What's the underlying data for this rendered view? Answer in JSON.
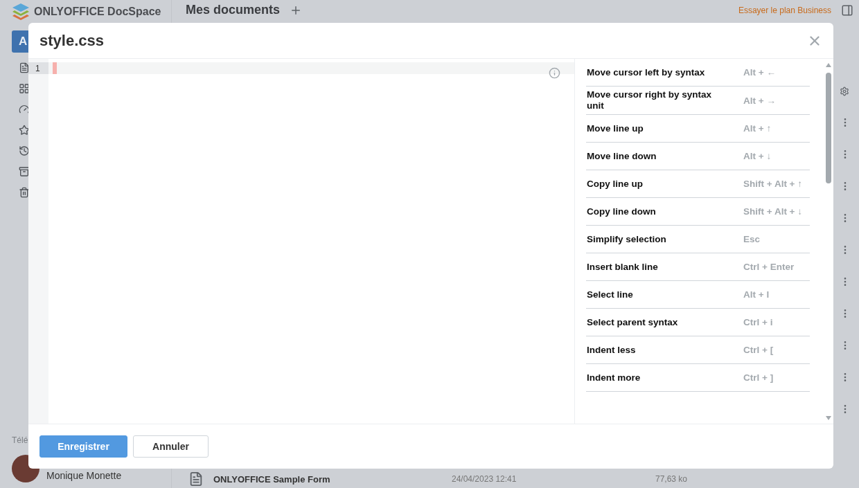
{
  "app": {
    "brand": "ONLYOFFICE DocSpace",
    "section_title": "Mes documents",
    "upgrade_link": "Essayer le plan Business",
    "sidebar_action": "A",
    "download_label": "Télé",
    "user_name": "Monique Monette"
  },
  "file_row": {
    "name": "ONLYOFFICE Sample Form",
    "modified": "24/04/2023 12:41",
    "size": "77,63 ko"
  },
  "dialog": {
    "title": "style.css",
    "editor": {
      "lines": [
        {
          "number": "1",
          "active": true
        }
      ]
    },
    "shortcuts": [
      {
        "name": "Move cursor left by syntax",
        "keys": "Alt + ←"
      },
      {
        "name": "Move cursor right by syntax unit",
        "keys": "Alt + →"
      },
      {
        "name": "Move line up",
        "keys": "Alt + ↑"
      },
      {
        "name": "Move line down",
        "keys": "Alt + ↓"
      },
      {
        "name": "Copy line up",
        "keys": "Shift + Alt + ↑"
      },
      {
        "name": "Copy line down",
        "keys": "Shift + Alt + ↓"
      },
      {
        "name": "Simplify selection",
        "keys": "Esc"
      },
      {
        "name": "Insert blank line",
        "keys": "Ctrl + Enter"
      },
      {
        "name": "Select line",
        "keys": "Alt + l"
      },
      {
        "name": "Select parent syntax",
        "keys": "Ctrl + i"
      },
      {
        "name": "Indent less",
        "keys": "Ctrl + ["
      },
      {
        "name": "Indent more",
        "keys": "Ctrl + ]"
      }
    ],
    "buttons": [
      {
        "label": "Enregistrer",
        "kind": "primary"
      },
      {
        "label": "Annuler",
        "kind": "secondary"
      }
    ]
  }
}
